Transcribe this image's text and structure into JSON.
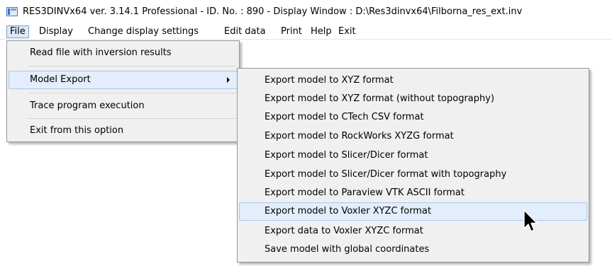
{
  "window": {
    "title": "RES3DINVx64 ver. 3.14.1 Professional - ID. No. : 890  - Display Window : D:\\Res3dinvx64\\Filborna_res_ext.inv",
    "icon": "app-window-icon"
  },
  "menubar": {
    "items": [
      {
        "label": "File",
        "active": true
      },
      {
        "label": "Display"
      },
      {
        "label": "Change display settings"
      },
      {
        "label": "Edit data"
      },
      {
        "label": "Print"
      },
      {
        "label": "Help"
      },
      {
        "label": "Exit"
      }
    ]
  },
  "file_menu": {
    "items": [
      {
        "label": "Read file with inversion results"
      },
      {
        "label": "Model Export",
        "has_submenu": true,
        "hover": true
      },
      {
        "label": "Trace program execution"
      },
      {
        "label": "Exit from this option"
      }
    ]
  },
  "model_export_submenu": {
    "items": [
      {
        "label": "Export model to XYZ format"
      },
      {
        "label": "Export model to XYZ format (without topography)"
      },
      {
        "label": "Export model to CTech CSV format"
      },
      {
        "label": "Export model to RockWorks XYZG format"
      },
      {
        "label": "Export model to Slicer/Dicer format"
      },
      {
        "label": "Export model to Slicer/Dicer format with topography"
      },
      {
        "label": "Export model to Paraview VTK ASCII format"
      },
      {
        "label": "Export model to Voxler XYZC format",
        "hover": true
      },
      {
        "label": "Export data to Voxler XYZC format"
      },
      {
        "label": "Save model with global coordinates"
      }
    ]
  },
  "colors": {
    "menu_background": "#f0f0f0",
    "hover_background": "#e3edfb",
    "hover_border": "#aac6ec",
    "active_menubar_background": "#dde9f7"
  },
  "cursor": {
    "icon": "mouse-pointer-icon"
  }
}
